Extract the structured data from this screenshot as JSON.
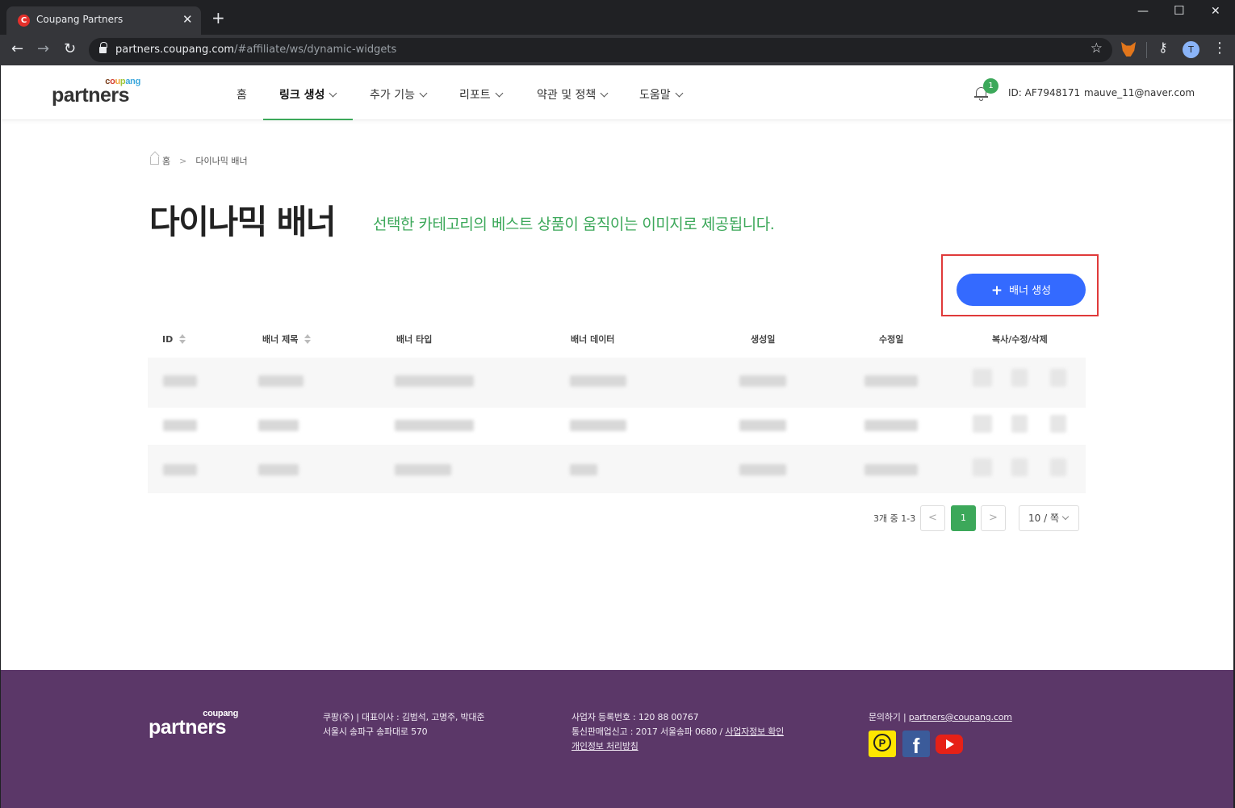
{
  "browser": {
    "tab_title": "Coupang Partners",
    "tab_favicon_letter": "C",
    "url_host": "partners.coupang.com",
    "url_path": "/#affiliate/ws/dynamic-widgets",
    "profile_initial": "T",
    "icons": [
      "back-icon",
      "forward-icon",
      "reload-icon",
      "lock-icon",
      "star-icon",
      "metamask-icon",
      "key-icon",
      "menu-icon"
    ]
  },
  "header": {
    "logo_small": "coupang",
    "logo_main": "partners",
    "nav": [
      {
        "label": "홈"
      },
      {
        "label": "링크 생성",
        "active": true
      },
      {
        "label": "추가 기능"
      },
      {
        "label": "리포트"
      },
      {
        "label": "약관 및 정책"
      },
      {
        "label": "도움말"
      }
    ],
    "notification_count": "1",
    "user_id": "ID: AF7948171",
    "user_email": "mauve_11@naver.com",
    "accent_color": "#3ca85a"
  },
  "breadcrumb": {
    "home": "홈",
    "separator": ">",
    "current": "다이나믹 배너"
  },
  "page": {
    "title": "다이나믹 배너",
    "subtitle": "선택한 카테고리의 베스트 상품이 움직이는 이미지로 제공됩니다.",
    "create_button": "배너 생성",
    "create_button_color": "#346aff"
  },
  "table": {
    "columns": [
      "ID",
      "배너 제목",
      "배너 타입",
      "배너 데이터",
      "생성일",
      "수정일",
      "복사/수정/삭제"
    ],
    "rows_note_hidden": true
  },
  "pagination": {
    "info": "3개 중 1-3",
    "prev": "<",
    "current": "1",
    "next": ">",
    "page_size": "10 / 쪽"
  },
  "footer": {
    "logo_small": "coupang",
    "logo_main": "partners",
    "company_line1": "쿠팡(주) | 대표이사 : 김범석, 고명주, 박대준",
    "company_line2": "서울시 송파구 송파대로 570",
    "biz_reg": "사업자 등록번호 : 120 88 00767",
    "commerce_prefix": "통신판매업신고 : 2017 서울송파 0680 / ",
    "commerce_link": "사업자정보 확인",
    "privacy": "개인정보 처리방침",
    "contact_prefix": "문의하기 | ",
    "contact_email": "partners@coupang.com",
    "background_color": "#5b3768"
  }
}
